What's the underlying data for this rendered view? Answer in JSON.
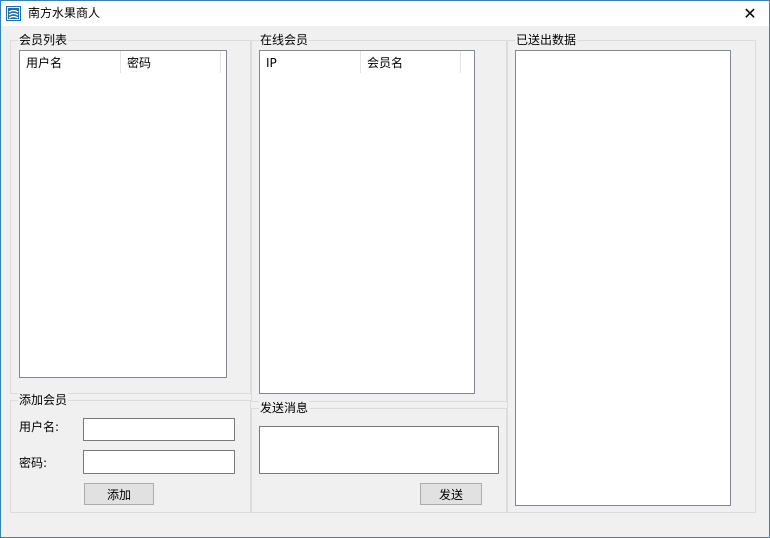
{
  "window": {
    "title": "南方水果商人",
    "close_glyph": "✕"
  },
  "member_list": {
    "caption": "会员列表",
    "columns": [
      "用户名",
      "密码"
    ]
  },
  "online_members": {
    "caption": "在线会员",
    "columns": [
      "IP",
      "会员名"
    ]
  },
  "sent_data": {
    "caption": "已送出数据"
  },
  "add_member": {
    "caption": "添加会员",
    "username_label": "用户名:",
    "username_value": "",
    "password_label": "密码:",
    "password_value": "",
    "add_button": "添加"
  },
  "send_message": {
    "caption": "发送消息",
    "message_value": "",
    "send_button": "发送"
  },
  "colors": {
    "window_border": "#3c7fb1",
    "background": "#f0f0f0",
    "icon_blue": "#1f6fae"
  }
}
